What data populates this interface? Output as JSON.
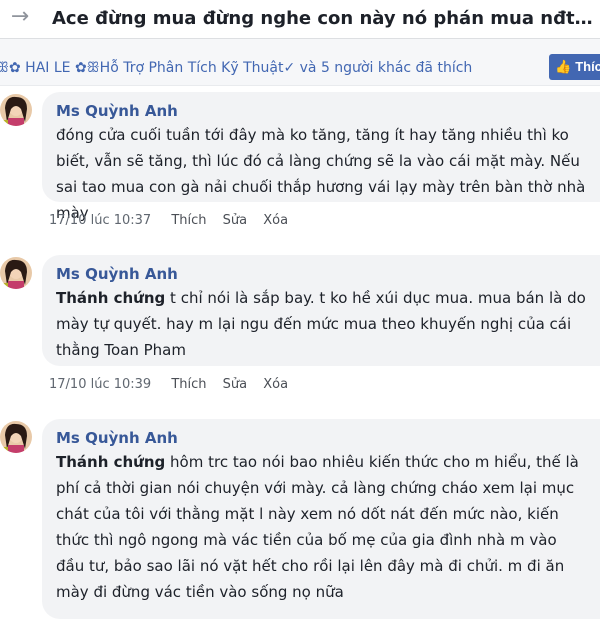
{
  "header": {
    "back_icon": "back-arrow-icon",
    "title": "Ace đừng mua đừng nghe con này nó phán mua nđt lỗ sắp ..."
  },
  "likes": {
    "text": "ꕥ✿ HAI LE ✿ꕥHỗ Trợ Phân Tích Kỹ Thuật✓ và 5 người khác đã thích",
    "button_label": "Thích",
    "button_icon": "thumbs-up-icon"
  },
  "comments": [
    {
      "author": "Ms Quỳnh Anh",
      "mention": "",
      "text": "đóng cửa cuối tuần tới đây mà ko tăng, tăng ít hay tăng nhiều thì ko biết, vẫn sẽ tăng, thì lúc đó cả làng chứng sẽ la vào cái mặt mày. Nếu sai tao mua con gà nải chuối thắp hương vái lạy mày trên bàn thờ nhà mày",
      "time": "17/10 lúc 10:37",
      "like_label": "Thích",
      "edit_label": "Sửa",
      "delete_label": "Xóa"
    },
    {
      "author": "Ms Quỳnh Anh",
      "mention": "Thánh chứng",
      "text": " t chỉ nói là sắp bay. t ko hề xúi dục mua. mua bán là do mày tự quyết. hay m lại ngu đến mức mua theo khuyến nghị của cái thằng Toan Pham",
      "time": "17/10 lúc 10:39",
      "like_label": "Thích",
      "edit_label": "Sửa",
      "delete_label": "Xóa"
    },
    {
      "author": "Ms Quỳnh Anh",
      "mention": "Thánh chứng",
      "text": " hôm trc tao nói bao nhiêu kiến thức cho m hiểu, thế là phí cả thời gian nói chuyện với mày. cả làng chứng cháo xem lại mục chát của tôi với thằng mặt l này xem nó dốt nát đến mức nào, kiến thức thì ngô ngong mà vác tiền của bố mẹ của gia đình nhà m vào đầu tư, bảo sao lãi nó vặt hết cho rồi lại lên đây mà đi chửi. m đi ăn mày đi đừng vác tiền vào sống nọ nữa",
      "time": "",
      "like_label": "",
      "edit_label": "",
      "delete_label": ""
    }
  ],
  "colors": {
    "link_blue": "#385898",
    "like_button_blue": "#4267b2",
    "bubble_bg": "#f2f3f5"
  }
}
